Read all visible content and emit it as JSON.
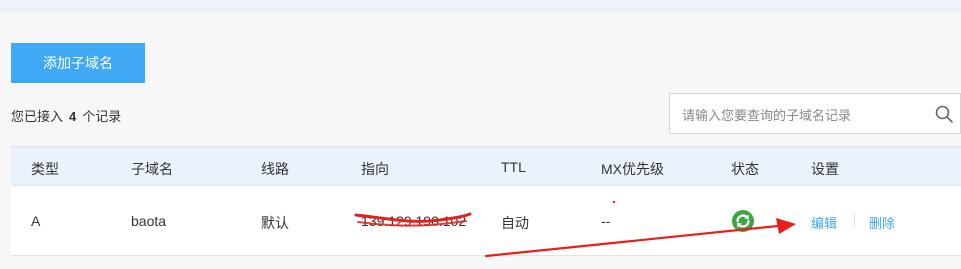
{
  "toolbar": {
    "add_button_label": "添加子域名"
  },
  "summary": {
    "prefix": "您已接入",
    "count": "4",
    "suffix": "个记录"
  },
  "search": {
    "placeholder": "请输入您要查询的子域名记录",
    "icon": "search-icon"
  },
  "table": {
    "headers": {
      "type": "类型",
      "subdomain": "子域名",
      "line": "线路",
      "target": "指向",
      "ttl": "TTL",
      "mx": "MX优先级",
      "status": "状态",
      "settings": "设置"
    },
    "rows": [
      {
        "type": "A",
        "subdomain": "baota",
        "line": "默认",
        "target": "139.129.190.102",
        "ttl": "自动",
        "mx": "--",
        "status_icon": "refresh-enabled-icon",
        "actions": {
          "edit": "编辑",
          "delete": "删除"
        }
      }
    ]
  },
  "colors": {
    "accent": "#3fa9f5",
    "header_bg": "#eaf3fc",
    "status_green": "#3aa643",
    "annotation_red": "#e8201b"
  }
}
